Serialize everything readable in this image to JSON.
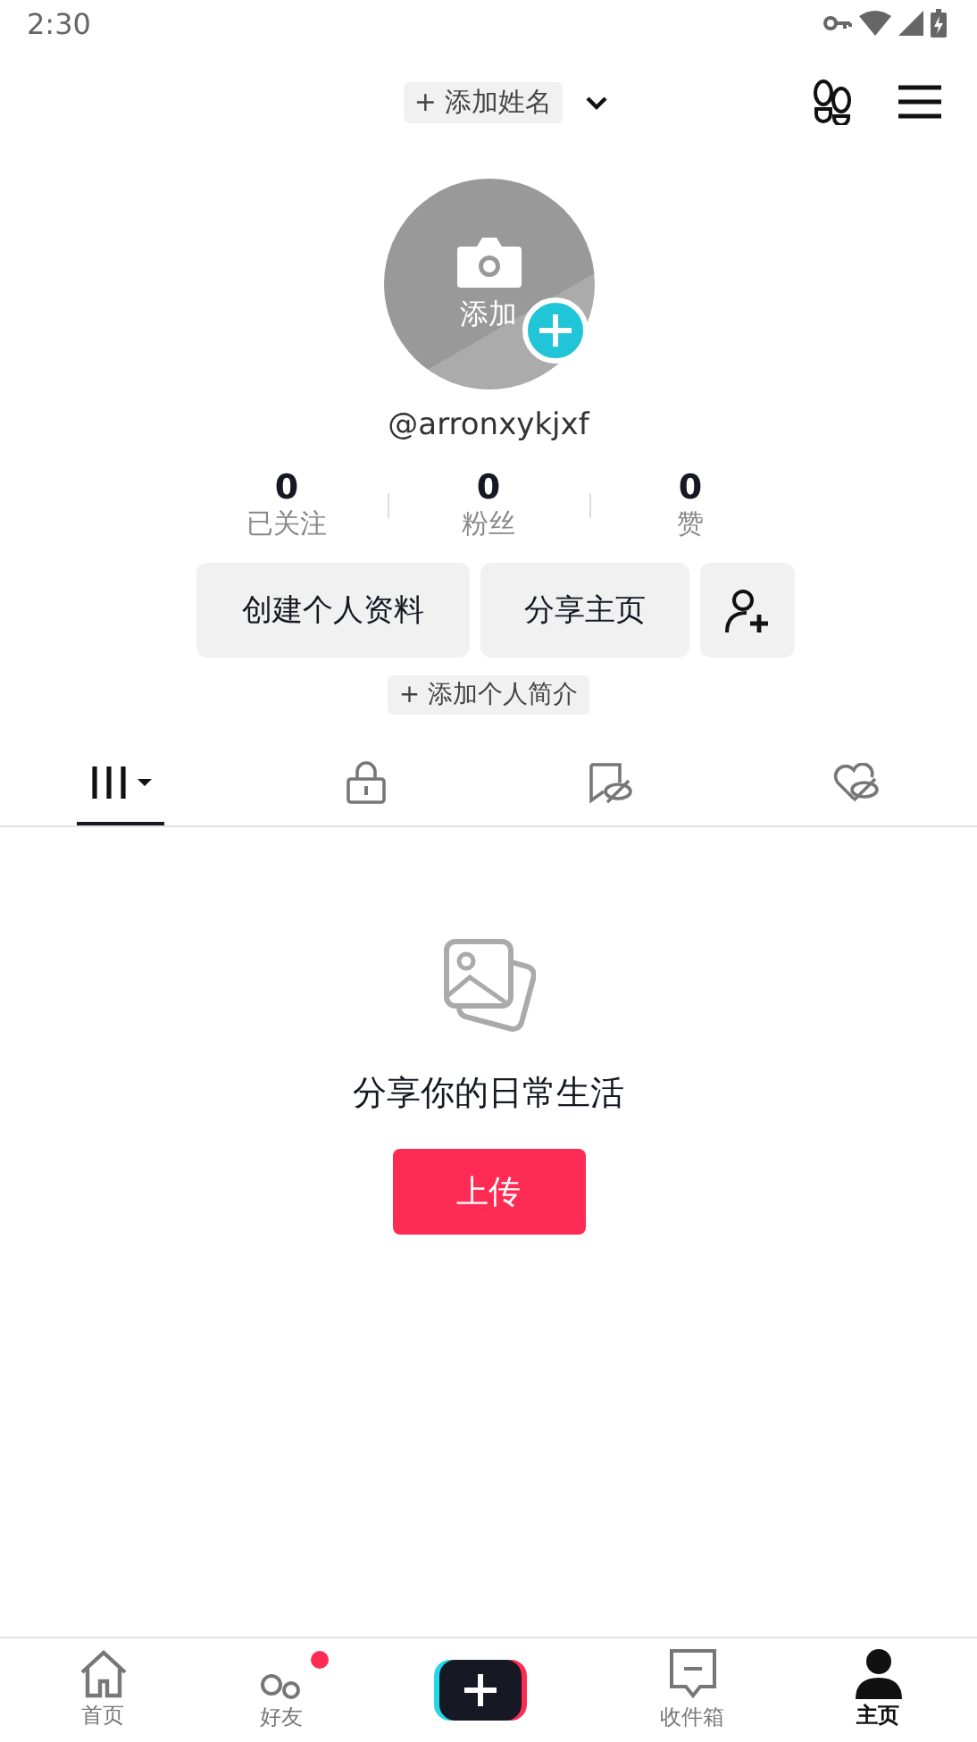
{
  "status_bar": {
    "time": "2:30"
  },
  "header": {
    "name_chip": "+ 添加姓名"
  },
  "avatar": {
    "label": "添加"
  },
  "handle": "@arronxykjxf",
  "stats": [
    {
      "value": "0",
      "label": "已关注"
    },
    {
      "value": "0",
      "label": "粉丝"
    },
    {
      "value": "0",
      "label": "赞"
    }
  ],
  "actions": [
    "创建个人资料",
    "分享主页"
  ],
  "bio_chip": "+ 添加个人简介",
  "tabs": [
    {
      "kind": "grid",
      "selected": true
    },
    {
      "kind": "lock",
      "selected": false
    },
    {
      "kind": "bookmark",
      "selected": false
    },
    {
      "kind": "heart",
      "selected": false
    }
  ],
  "empty_state": {
    "message": "分享你的日常生活",
    "button": "上传"
  },
  "nav": [
    {
      "kind": "home",
      "label": "首页",
      "selected": false
    },
    {
      "kind": "friends",
      "label": "好友",
      "selected": false,
      "badge": true
    },
    {
      "kind": "create"
    },
    {
      "kind": "inbox",
      "label": "收件箱",
      "selected": false
    },
    {
      "kind": "profile",
      "label": "主页",
      "selected": true
    }
  ]
}
